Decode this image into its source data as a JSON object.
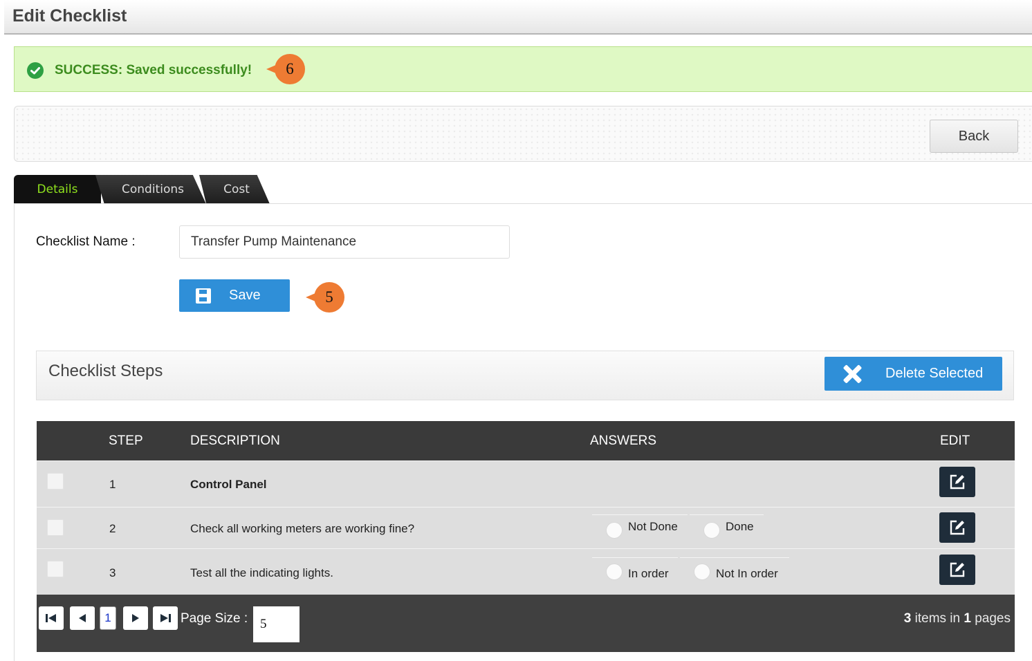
{
  "header": {
    "title": "Edit Checklist"
  },
  "alert": {
    "text": "SUCCESS: Saved successfully!"
  },
  "callouts": {
    "alert": "6",
    "save": "5"
  },
  "toolbar": {
    "back_label": "Back"
  },
  "tabs": [
    {
      "label": "Details",
      "active": true
    },
    {
      "label": "Conditions",
      "active": false
    },
    {
      "label": "Cost",
      "active": false
    }
  ],
  "form": {
    "name_label": "Checklist Name :",
    "name_value": "Transfer Pump Maintenance",
    "save_label": "Save"
  },
  "steps_panel": {
    "title": "Checklist Steps",
    "delete_label": "Delete Selected"
  },
  "grid": {
    "columns": {
      "step": "STEP",
      "description": "DESCRIPTION",
      "answers": "ANSWERS",
      "edit": "EDIT"
    },
    "rows": [
      {
        "step": "1",
        "description": "Control Panel",
        "bold": true,
        "answers": []
      },
      {
        "step": "2",
        "description": "Check all working meters are working fine?",
        "bold": false,
        "answers": [
          "Not Done",
          "Done"
        ]
      },
      {
        "step": "3",
        "description": "Test all the indicating lights.",
        "bold": false,
        "answers": [
          "In order",
          "Not In order"
        ]
      }
    ]
  },
  "pager": {
    "current_page": "1",
    "page_size_label": "Page Size :",
    "page_size": "5",
    "item_count": "3",
    "items_in_text": " items in ",
    "page_count": "1",
    "pages_text": " pages"
  },
  "colors": {
    "success_bg": "#dff9c4",
    "success_text": "#3c8c1e",
    "primary_button": "#2f8fd8",
    "callout": "#ee7b33",
    "active_tab_text": "#8fe11e",
    "grid_header": "#3a3a3a"
  }
}
